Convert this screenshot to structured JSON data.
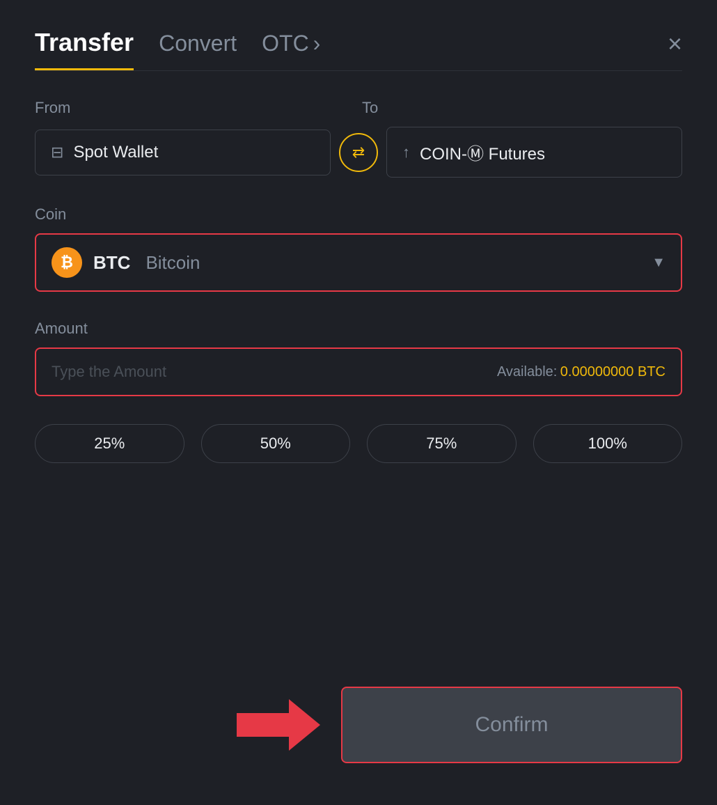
{
  "header": {
    "tab_transfer": "Transfer",
    "tab_convert": "Convert",
    "tab_otc": "OTC",
    "tab_otc_chevron": "›",
    "close_label": "×"
  },
  "from_section": {
    "label": "From",
    "wallet_name": "Spot Wallet"
  },
  "to_section": {
    "label": "To",
    "futures_name": "COIN-Ⓜ Futures"
  },
  "coin_section": {
    "label": "Coin",
    "coin_ticker": "BTC",
    "coin_name": "Bitcoin",
    "coin_symbol": "₿"
  },
  "amount_section": {
    "label": "Amount",
    "placeholder": "Type the Amount",
    "available_label": "Available:",
    "available_amount": "0.00000000 BTC"
  },
  "percent_buttons": [
    "25%",
    "50%",
    "75%",
    "100%"
  ],
  "confirm_button": "Confirm"
}
